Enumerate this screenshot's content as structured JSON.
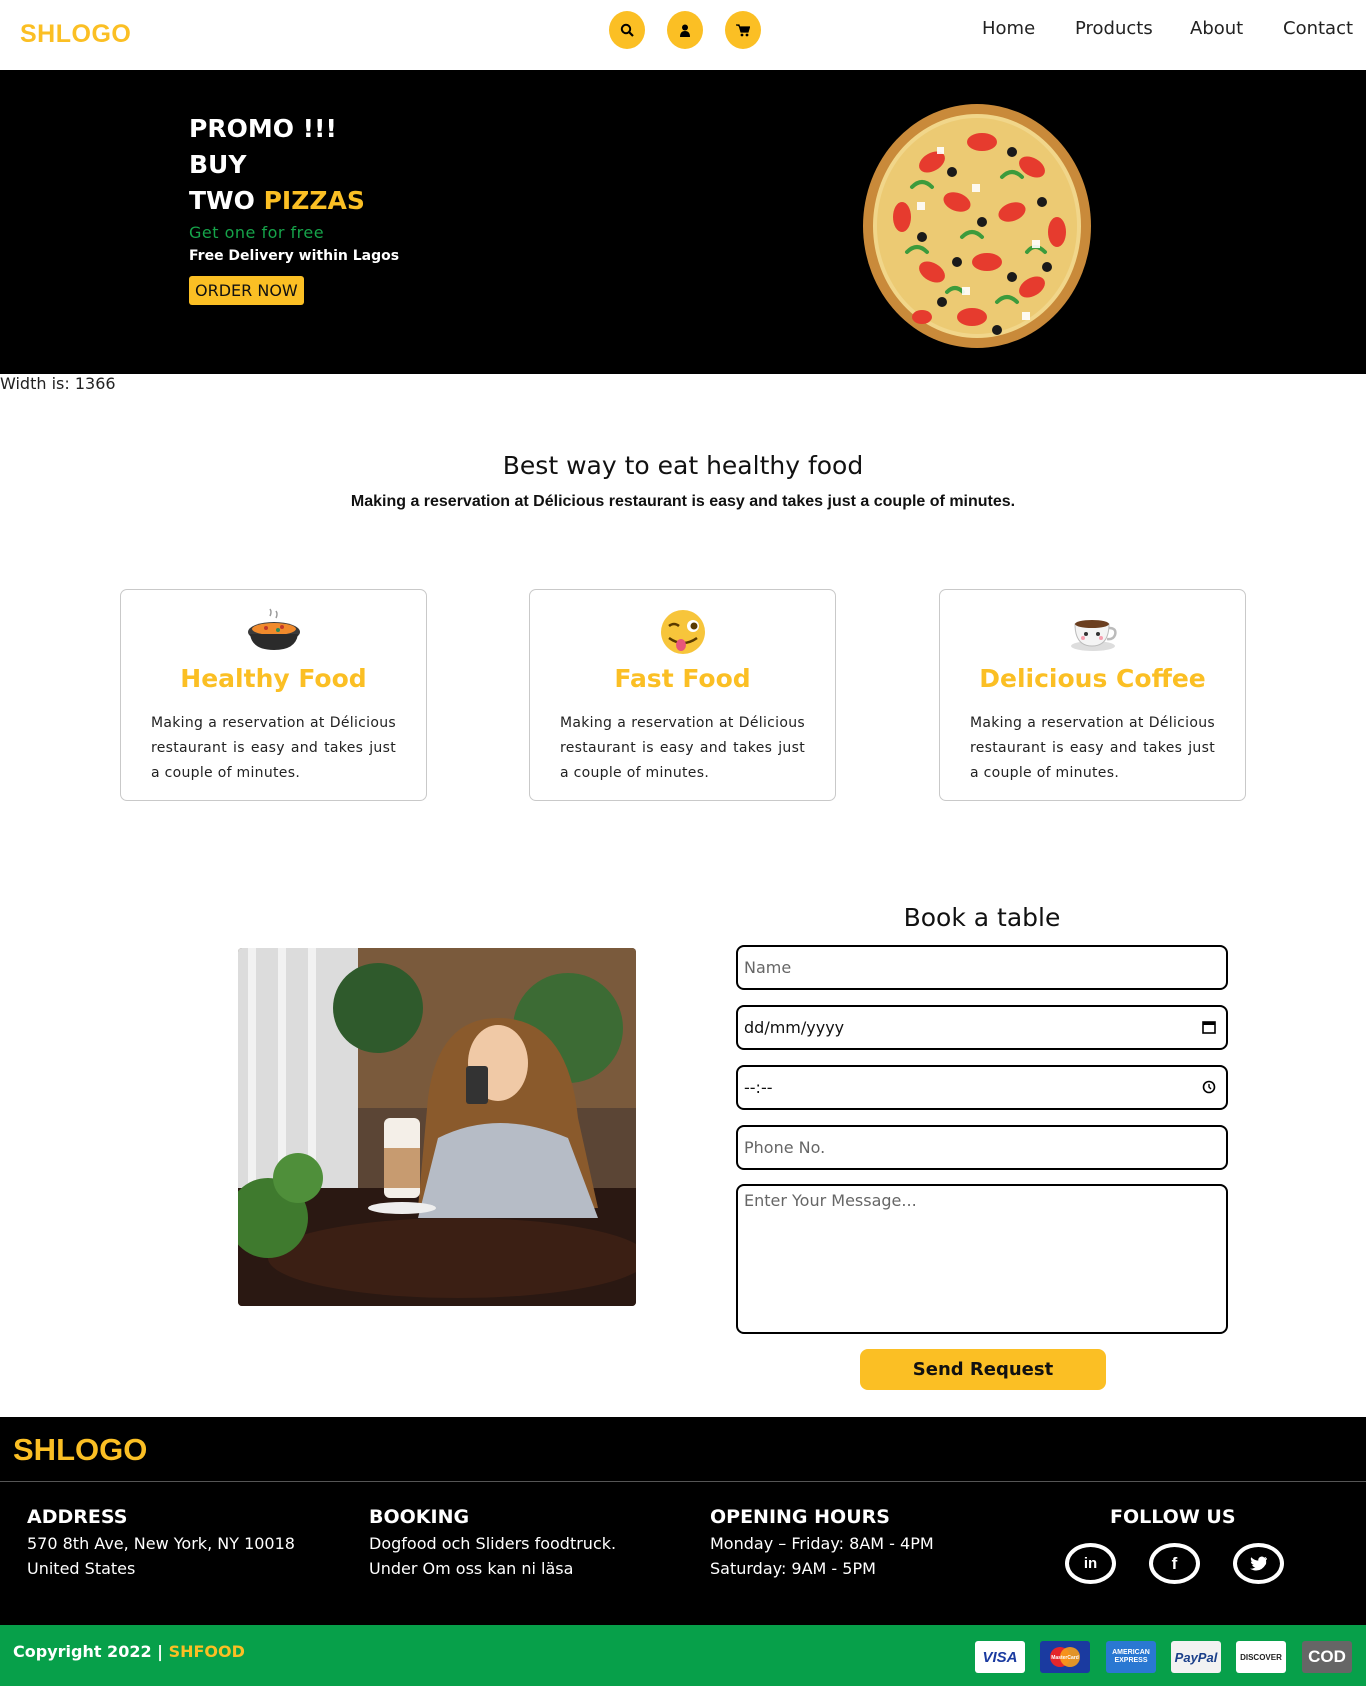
{
  "header": {
    "logo": "SHLOGO",
    "icons": [
      "search-icon",
      "user-icon",
      "cart-icon"
    ],
    "nav": [
      "Home",
      "Products",
      "About",
      "Contact"
    ]
  },
  "hero": {
    "line1": "PROMO !!!",
    "line2": "BUY",
    "line3a": "TWO",
    "line3b": "PIZZAS",
    "tagline": "Get one for free",
    "delivery": "Free Delivery within Lagos",
    "cta": "ORDER NOW"
  },
  "width_text": "Width is: 1366",
  "intro": {
    "title": "Best way to eat healthy food",
    "subtitle": "Making a reservation at Délicious restaurant is easy and takes just a couple of minutes."
  },
  "cards": [
    {
      "icon": "pot-icon",
      "title": "Healthy Food",
      "text": "Making a reservation at Délicious restaurant is easy and takes just a couple of minutes."
    },
    {
      "icon": "winking-face-icon",
      "title": "Fast Food",
      "text": "Making a reservation at Délicious restaurant is easy and takes just a couple of minutes."
    },
    {
      "icon": "coffee-cup-icon",
      "title": "Delicious Coffee",
      "text": "Making a reservation at Délicious restaurant is easy and takes just a couple of minutes."
    }
  ],
  "booking": {
    "title": "Book a table",
    "name_placeholder": "Name",
    "date_value": "dd/mm/yyyy",
    "time_value": "--:--",
    "phone_placeholder": "Phone No.",
    "message_placeholder": "Enter Your Message...",
    "submit": "Send Request"
  },
  "footer": {
    "logo": "SHLOGO",
    "address": {
      "heading": "ADDRESS",
      "line1": "570 8th Ave, New York, NY 10018",
      "line2": "United States"
    },
    "booking": {
      "heading": "BOOKING",
      "line1": "Dogfood och Sliders foodtruck.",
      "line2": "Under Om oss kan ni läsa"
    },
    "hours": {
      "heading": "OPENING HOURS",
      "line1": "Monday – Friday: 8AM - 4PM",
      "line2": "Saturday: 9AM - 5PM"
    },
    "follow": {
      "heading": "FOLLOW US",
      "icons": [
        "linkedin-icon",
        "facebook-icon",
        "twitter-icon"
      ]
    },
    "copyright": "Copyright 2022 |",
    "brand": "SHFOOD",
    "payments": [
      "VISA",
      "MasterCard",
      "AMERICAN EXPRESS",
      "PayPal",
      "DISCOVER",
      "COD"
    ]
  },
  "colors": {
    "accent": "#fbbf24",
    "green": "#07a04a",
    "black": "#000000"
  }
}
